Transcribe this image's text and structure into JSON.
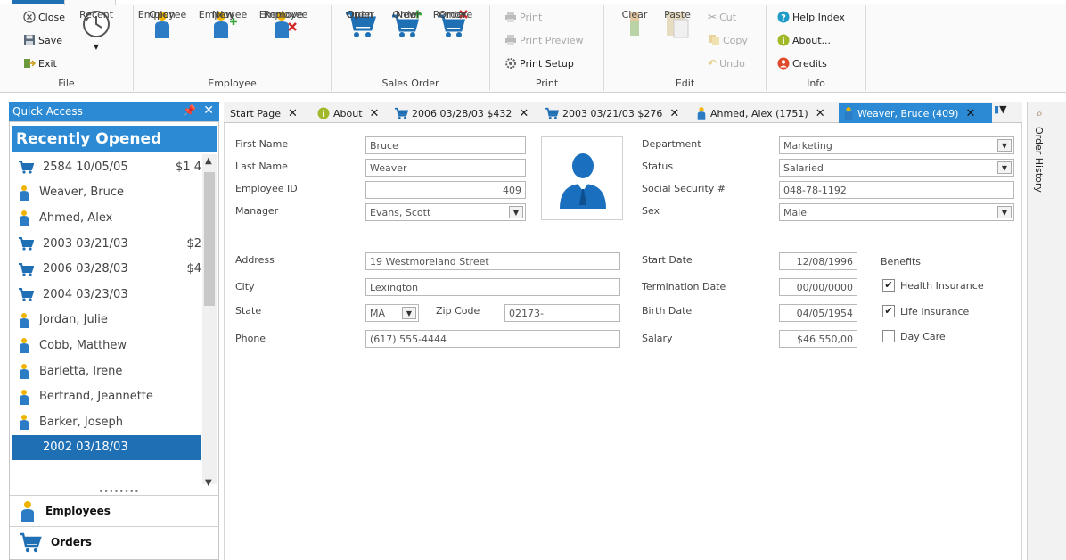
{
  "ribbon": {
    "file_group": {
      "close": "Close",
      "save": "Save",
      "exit": "Exit",
      "recent": "Recent",
      "label": "File"
    },
    "employee_group": {
      "open": [
        "Open",
        "Employee"
      ],
      "new": [
        "New",
        "Employee"
      ],
      "remove": [
        "Remove",
        "Employee"
      ],
      "label": "Employee"
    },
    "sales_group": {
      "open": [
        "Open",
        "Order"
      ],
      "new": [
        "New",
        "Order"
      ],
      "remove": [
        "Remove",
        "Order"
      ],
      "label": "Sales Order"
    },
    "print_group": {
      "print": "Print",
      "preview": "Print Preview",
      "setup": "Print Setup",
      "label": "Print"
    },
    "edit_group": {
      "clear": "Clear",
      "paste": "Paste",
      "cut": "Cut",
      "copy": "Copy",
      "undo": "Undo",
      "label": "Edit"
    },
    "info_group": {
      "help": "Help Index",
      "about": "About...",
      "credits": "Credits",
      "label": "Info"
    }
  },
  "quick_access": {
    "title": "Quick Access",
    "recent_title": "Recently Opened",
    "items": [
      {
        "type": "order",
        "text": "2584 10/05/05",
        "amount": "$1 4"
      },
      {
        "type": "employee",
        "text": "Weaver, Bruce",
        "amount": ""
      },
      {
        "type": "employee",
        "text": "Ahmed, Alex",
        "amount": ""
      },
      {
        "type": "order",
        "text": "2003 03/21/03",
        "amount": "$2"
      },
      {
        "type": "order",
        "text": "2006 03/28/03",
        "amount": "$4"
      },
      {
        "type": "order",
        "text": "2004 03/23/03",
        "amount": ""
      },
      {
        "type": "employee",
        "text": "Jordan, Julie",
        "amount": ""
      },
      {
        "type": "employee",
        "text": "Cobb, Matthew",
        "amount": ""
      },
      {
        "type": "employee",
        "text": "Barletta, Irene",
        "amount": ""
      },
      {
        "type": "employee",
        "text": "Bertrand, Jeannette",
        "amount": ""
      },
      {
        "type": "employee",
        "text": "Barker, Joseph",
        "amount": ""
      },
      {
        "type": "order",
        "text": "2002 03/18/03",
        "amount": "",
        "selected": true
      }
    ],
    "nav": {
      "employees": "Employees",
      "orders": "Orders"
    }
  },
  "tabs": [
    {
      "label": "Start Page",
      "icon": "none"
    },
    {
      "label": "About",
      "icon": "info"
    },
    {
      "label": "2006 03/28/03 $432",
      "icon": "cart"
    },
    {
      "label": "2003 03/21/03 $276",
      "icon": "cart"
    },
    {
      "label": "Ahmed, Alex (1751)",
      "icon": "person"
    },
    {
      "label": "Weaver, Bruce (409)",
      "icon": "person",
      "active": true
    }
  ],
  "form": {
    "first_name": {
      "label": "First Name",
      "value": "Bruce"
    },
    "last_name": {
      "label": "Last Name",
      "value": "Weaver"
    },
    "employee_id": {
      "label": "Employee ID",
      "value": "409"
    },
    "manager": {
      "label": "Manager",
      "value": "Evans, Scott"
    },
    "department": {
      "label": "Department",
      "value": "Marketing"
    },
    "status": {
      "label": "Status",
      "value": "Salaried"
    },
    "ssn": {
      "label": "Social Security #",
      "value": "048-78-1192"
    },
    "sex": {
      "label": "Sex",
      "value": "Male"
    },
    "address": {
      "label": "Address",
      "value": "19 Westmoreland Street"
    },
    "city": {
      "label": "City",
      "value": "Lexington"
    },
    "state": {
      "label": "State",
      "value": "MA"
    },
    "zip": {
      "label": "Zip Code",
      "value": "02173-"
    },
    "phone": {
      "label": "Phone",
      "value": "(617) 555-4444"
    },
    "start_date": {
      "label": "Start Date",
      "value": "12/08/1996"
    },
    "termination_date": {
      "label": "Termination Date",
      "value": "00/00/0000"
    },
    "birth_date": {
      "label": "Birth Date",
      "value": "04/05/1954"
    },
    "salary": {
      "label": "Salary",
      "value": "$46 550,00"
    },
    "benefits": {
      "label": "Benefits",
      "health": {
        "label": "Health Insurance",
        "checked": true
      },
      "life": {
        "label": "Life Insurance",
        "checked": true
      },
      "daycare": {
        "label": "Day Care",
        "checked": false
      }
    }
  },
  "side_panel": {
    "label": "Order History"
  },
  "colors": {
    "accent": "#2b8ad3",
    "selected": "#1f6fb5",
    "person_icon": "#2b7cc4",
    "cart_icon": "#1f6fb5"
  }
}
